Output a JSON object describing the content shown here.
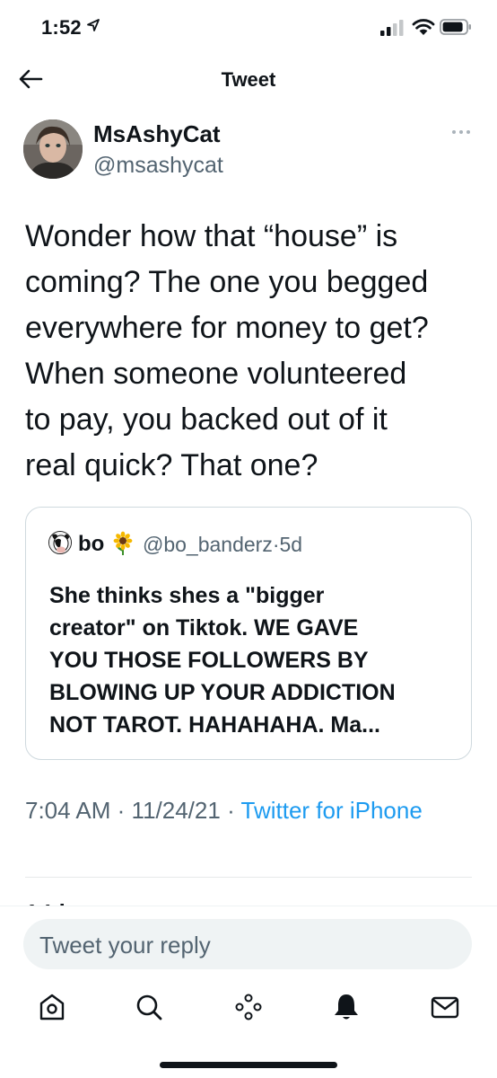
{
  "status_bar": {
    "time": "1:52"
  },
  "header": {
    "title": "Tweet"
  },
  "tweet": {
    "author_name": "MsAshyCat",
    "author_handle": "@msashycat",
    "text_lines": [
      "Wonder how that “house” is",
      "coming? The one you begged",
      "everywhere for money to get?",
      "When someone volunteered",
      "to pay, you backed out of it",
      "real quick? That one?"
    ],
    "quoted": {
      "name": "bo",
      "name_emoji": "sunflower",
      "handle": "@bo_banderz",
      "separator": "·",
      "age": "5d",
      "text_lines": [
        "She thinks shes a \"bigger",
        "creator\" on Tiktok. WE GAVE",
        "YOU THOSE FOLLOWERS BY",
        "BLOWING UP YOUR ADDICTION",
        "NOT TAROT. HAHAHAHA. Ma..."
      ]
    },
    "time": "7:04 AM",
    "separator": "·",
    "date": "11/24/21",
    "source": "Twitter for iPhone"
  },
  "reply": {
    "placeholder": "Tweet your reply"
  },
  "tabs": [
    {
      "icon": "home-icon"
    },
    {
      "icon": "search-icon"
    },
    {
      "icon": "spaces-icon"
    },
    {
      "icon": "notifications-bell-icon"
    },
    {
      "icon": "messages-envelope-icon"
    }
  ],
  "colors": {
    "text": "#0f1419",
    "secondary": "#536471",
    "accent": "#1d9bf0",
    "border": "#cfd9de",
    "input_bg": "#eff3f4"
  }
}
